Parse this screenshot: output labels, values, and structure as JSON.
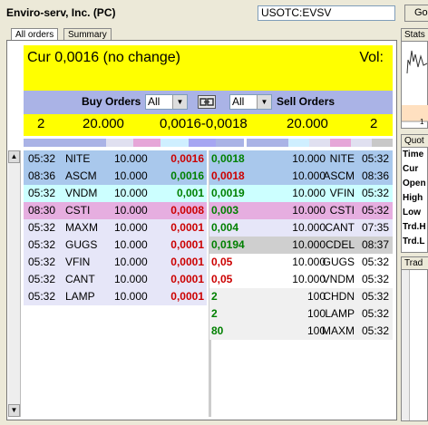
{
  "header": {
    "company": "Enviro-serv, Inc. (PC)",
    "symbol": "USOTC:EVSV",
    "go_label": "Go"
  },
  "tabs": [
    {
      "label": "All orders",
      "active": true
    },
    {
      "label": "Summary",
      "active": false
    }
  ],
  "right_tabs": {
    "stats": "Stats",
    "quote": "Quot",
    "trades": "Trad"
  },
  "right_labels": [
    "Time",
    "Cur",
    "Open",
    "High",
    "Low",
    "Trd.H",
    "Trd.L"
  ],
  "right_chart_tick": "1",
  "quote_bar": {
    "cur_text": "Cur 0,0016 (no change)",
    "vol_label": "Vol:"
  },
  "controls": {
    "buy_label": "Buy Orders",
    "buy_filter": "All",
    "sell_filter": "All",
    "sell_label": "Sell Orders"
  },
  "summary": {
    "buy_count": "2",
    "buy_size": "20.000",
    "spread": "0,0016-0,0018",
    "sell_size": "20.000",
    "sell_count": "2"
  },
  "bid_bar_colors": [
    "#aab3e6",
    "#aab3e6",
    "#aab3e6",
    "#e0e0f0",
    "#e6a6d8",
    "#cfefff",
    "#a6a6f2",
    "#aab3e6"
  ],
  "ask_bar_colors": [
    "#aab3e6",
    "#aab3e6",
    "#cfefff",
    "#e0e0f0",
    "#e6a6d8",
    "#e0e0f0",
    "#c8c8c8"
  ],
  "bids": [
    {
      "time": "05:32",
      "mm": "NITE",
      "size": "10.000",
      "price": "0,0016",
      "pc": "red",
      "bg": "#a9c8ec"
    },
    {
      "time": "08:36",
      "mm": "ASCM",
      "size": "10.000",
      "price": "0,0016",
      "pc": "grn",
      "bg": "#a9c8ec"
    },
    {
      "time": "05:32",
      "mm": "VNDM",
      "size": "10.000",
      "price": "0,001",
      "pc": "grn",
      "bg": "#ccffff"
    },
    {
      "time": "08:30",
      "mm": "CSTI",
      "size": "10.000",
      "price": "0,0008",
      "pc": "red",
      "bg": "#e6aee0"
    },
    {
      "time": "05:32",
      "mm": "MAXM",
      "size": "10.000",
      "price": "0,0001",
      "pc": "red",
      "bg": "#e6e6f8"
    },
    {
      "time": "05:32",
      "mm": "GUGS",
      "size": "10.000",
      "price": "0,0001",
      "pc": "red",
      "bg": "#e6e6f8"
    },
    {
      "time": "05:32",
      "mm": "VFIN",
      "size": "10.000",
      "price": "0,0001",
      "pc": "red",
      "bg": "#e6e6f8"
    },
    {
      "time": "05:32",
      "mm": "CANT",
      "size": "10.000",
      "price": "0,0001",
      "pc": "red",
      "bg": "#e6e6f8"
    },
    {
      "time": "05:32",
      "mm": "LAMP",
      "size": "10.000",
      "price": "0,0001",
      "pc": "red",
      "bg": "#e6e6f8"
    }
  ],
  "asks": [
    {
      "price": "0,0018",
      "pc": "grn",
      "size": "10.000",
      "mm": "NITE",
      "time": "05:32",
      "bg": "#a9c8ec"
    },
    {
      "price": "0,0018",
      "pc": "red",
      "size": "10.000",
      "mm": "ASCM",
      "time": "08:36",
      "bg": "#a9c8ec"
    },
    {
      "price": "0,0019",
      "pc": "grn",
      "size": "10.000",
      "mm": "VFIN",
      "time": "05:32",
      "bg": "#ccffff"
    },
    {
      "price": "0,003",
      "pc": "grn",
      "size": "10.000",
      "mm": "CSTI",
      "time": "05:32",
      "bg": "#e6aee0"
    },
    {
      "price": "0,004",
      "pc": "grn",
      "size": "10.000",
      "mm": "CANT",
      "time": "07:35",
      "bg": "#e6e6f8"
    },
    {
      "price": "0,0194",
      "pc": "grn",
      "size": "10.000",
      "mm": "CDEL",
      "time": "08:37",
      "bg": "#cfcfcf"
    },
    {
      "price": "0,05",
      "pc": "red",
      "size": "10.000",
      "mm": "GUGS",
      "time": "05:32",
      "bg": "#ffffff"
    },
    {
      "price": "0,05",
      "pc": "red",
      "size": "10.000",
      "mm": "VNDM",
      "time": "05:32",
      "bg": "#ffffff"
    },
    {
      "price": "2",
      "pc": "grn",
      "size": "100",
      "mm": "CHDN",
      "time": "05:32",
      "bg": "#f0f0f0"
    },
    {
      "price": "2",
      "pc": "grn",
      "size": "100",
      "mm": "LAMP",
      "time": "05:32",
      "bg": "#f0f0f0"
    },
    {
      "price": "80",
      "pc": "grn",
      "size": "100",
      "mm": "MAXM",
      "time": "05:32",
      "bg": "#f0f0f0"
    }
  ]
}
